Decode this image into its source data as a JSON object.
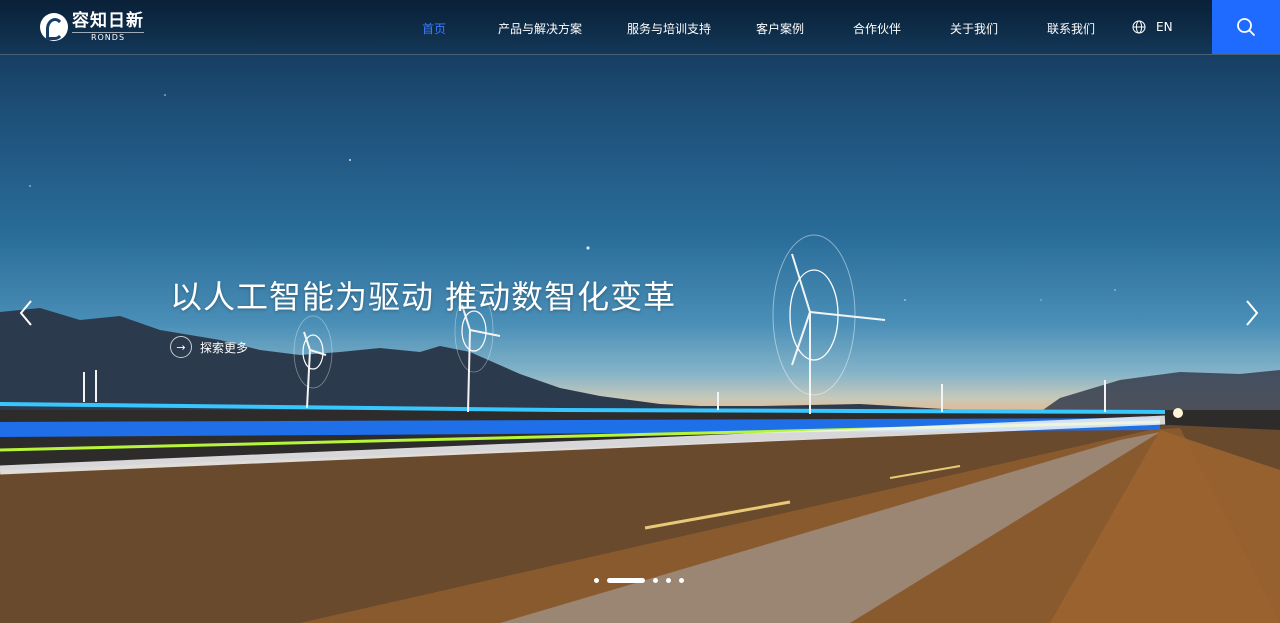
{
  "header": {
    "logo": {
      "cn": "容知日新",
      "en": "RONDS"
    },
    "nav": [
      {
        "label": "首页",
        "active": true
      },
      {
        "label": "产品与解决方案",
        "active": false
      },
      {
        "label": "服务与培训支持",
        "active": false
      },
      {
        "label": "客户案例",
        "active": false
      },
      {
        "label": "合作伙伴",
        "active": false
      },
      {
        "label": "关于我们",
        "active": false
      },
      {
        "label": "联系我们",
        "active": false
      }
    ],
    "language": "EN",
    "icons": {
      "language": "globe-icon",
      "search": "search-icon"
    }
  },
  "hero": {
    "headline": "以人工智能为驱动 推动数智化变革",
    "explore_label": "探索更多",
    "icons": {
      "prev": "chevron-left-icon",
      "next": "chevron-right-icon",
      "explore": "arrow-right-icon"
    },
    "slides": {
      "count": 5,
      "active_index": 1
    }
  },
  "colors": {
    "accent": "#1f6bff",
    "nav_active": "#3a7bff"
  }
}
